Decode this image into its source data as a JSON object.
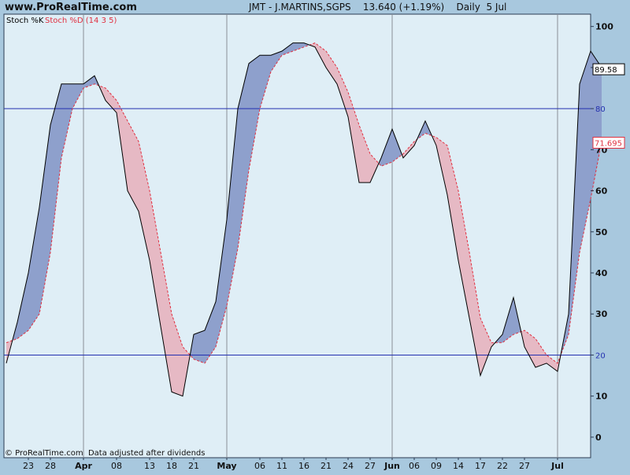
{
  "header": {
    "site": "www.ProRealTime.com",
    "symbol_info": "JMT - J.MARTINS,SGPS    13.640 (+1.19%)    Daily  5 Jul"
  },
  "legend": {
    "k_label": "Stoch %K",
    "d_label": "Stoch %D (14 3 5)"
  },
  "footer": {
    "note": "© ProRealTime.com  Data adjusted after dividends"
  },
  "colors": {
    "background": "#a8c8de",
    "plot_background": "#dfeef6",
    "k_line": "#000000",
    "d_line": "#e03040",
    "fill_k_above": "#8ea0cc",
    "fill_d_above": "#e6b9c4",
    "level_line": "#2430b0",
    "k_value_text": "#000000",
    "d_value_text": "#e03040",
    "level_text": "#2430b0"
  },
  "chart_data": {
    "type": "line",
    "title": "JMT - J.MARTINS,SGPS",
    "ylim": [
      -5,
      103
    ],
    "y_ticks": [
      0,
      10,
      20,
      30,
      40,
      50,
      60,
      70,
      80,
      90,
      100
    ],
    "levels": [
      {
        "value": 80,
        "label": "80"
      },
      {
        "value": 20,
        "label": "20"
      }
    ],
    "x_labels": [
      {
        "i": 2,
        "label": "23",
        "bold": false
      },
      {
        "i": 4,
        "label": "28",
        "bold": false
      },
      {
        "i": 7,
        "label": "Apr",
        "bold": true
      },
      {
        "i": 10,
        "label": "08",
        "bold": false
      },
      {
        "i": 13,
        "label": "13",
        "bold": false
      },
      {
        "i": 15,
        "label": "18",
        "bold": false
      },
      {
        "i": 17,
        "label": "21",
        "bold": false
      },
      {
        "i": 20,
        "label": "May",
        "bold": true
      },
      {
        "i": 23,
        "label": "06",
        "bold": false
      },
      {
        "i": 25,
        "label": "11",
        "bold": false
      },
      {
        "i": 27,
        "label": "16",
        "bold": false
      },
      {
        "i": 29,
        "label": "21",
        "bold": false
      },
      {
        "i": 31,
        "label": "24",
        "bold": false
      },
      {
        "i": 33,
        "label": "27",
        "bold": false
      },
      {
        "i": 35,
        "label": "Jun",
        "bold": true
      },
      {
        "i": 37,
        "label": "06",
        "bold": false
      },
      {
        "i": 39,
        "label": "09",
        "bold": false
      },
      {
        "i": 41,
        "label": "14",
        "bold": false
      },
      {
        "i": 43,
        "label": "17",
        "bold": false
      },
      {
        "i": 45,
        "label": "22",
        "bold": false
      },
      {
        "i": 47,
        "label": "27",
        "bold": false
      },
      {
        "i": 50,
        "label": "Jul",
        "bold": true
      }
    ],
    "month_separators": [
      7,
      20,
      35,
      50
    ],
    "series": [
      {
        "name": "Stoch %K",
        "values": [
          18,
          28,
          40,
          56,
          76,
          86,
          86,
          86,
          88,
          82,
          79,
          60,
          55,
          43,
          27,
          11,
          10,
          25,
          26,
          33,
          53,
          80,
          91,
          93,
          93,
          94,
          96,
          96,
          95,
          90,
          86,
          78,
          62,
          62,
          68,
          75,
          68,
          71,
          77,
          71,
          59,
          43,
          29,
          15,
          22,
          25,
          34,
          22,
          17,
          18,
          16,
          30,
          86,
          94,
          90
        ],
        "last_value": "89.58"
      },
      {
        "name": "Stoch %D (14 3 5)",
        "values": [
          23,
          24,
          26,
          30,
          45,
          68,
          80,
          85,
          86,
          85,
          82,
          77,
          72,
          60,
          45,
          30,
          22,
          19,
          18,
          22,
          32,
          46,
          65,
          80,
          89,
          93,
          94,
          95,
          96,
          94,
          90,
          84,
          76,
          69,
          66,
          67,
          69,
          72,
          74,
          73,
          71,
          60,
          45,
          29,
          23,
          23,
          25,
          26,
          24,
          20,
          18,
          25,
          45,
          58,
          72
        ],
        "last_value": "71.695"
      }
    ]
  }
}
